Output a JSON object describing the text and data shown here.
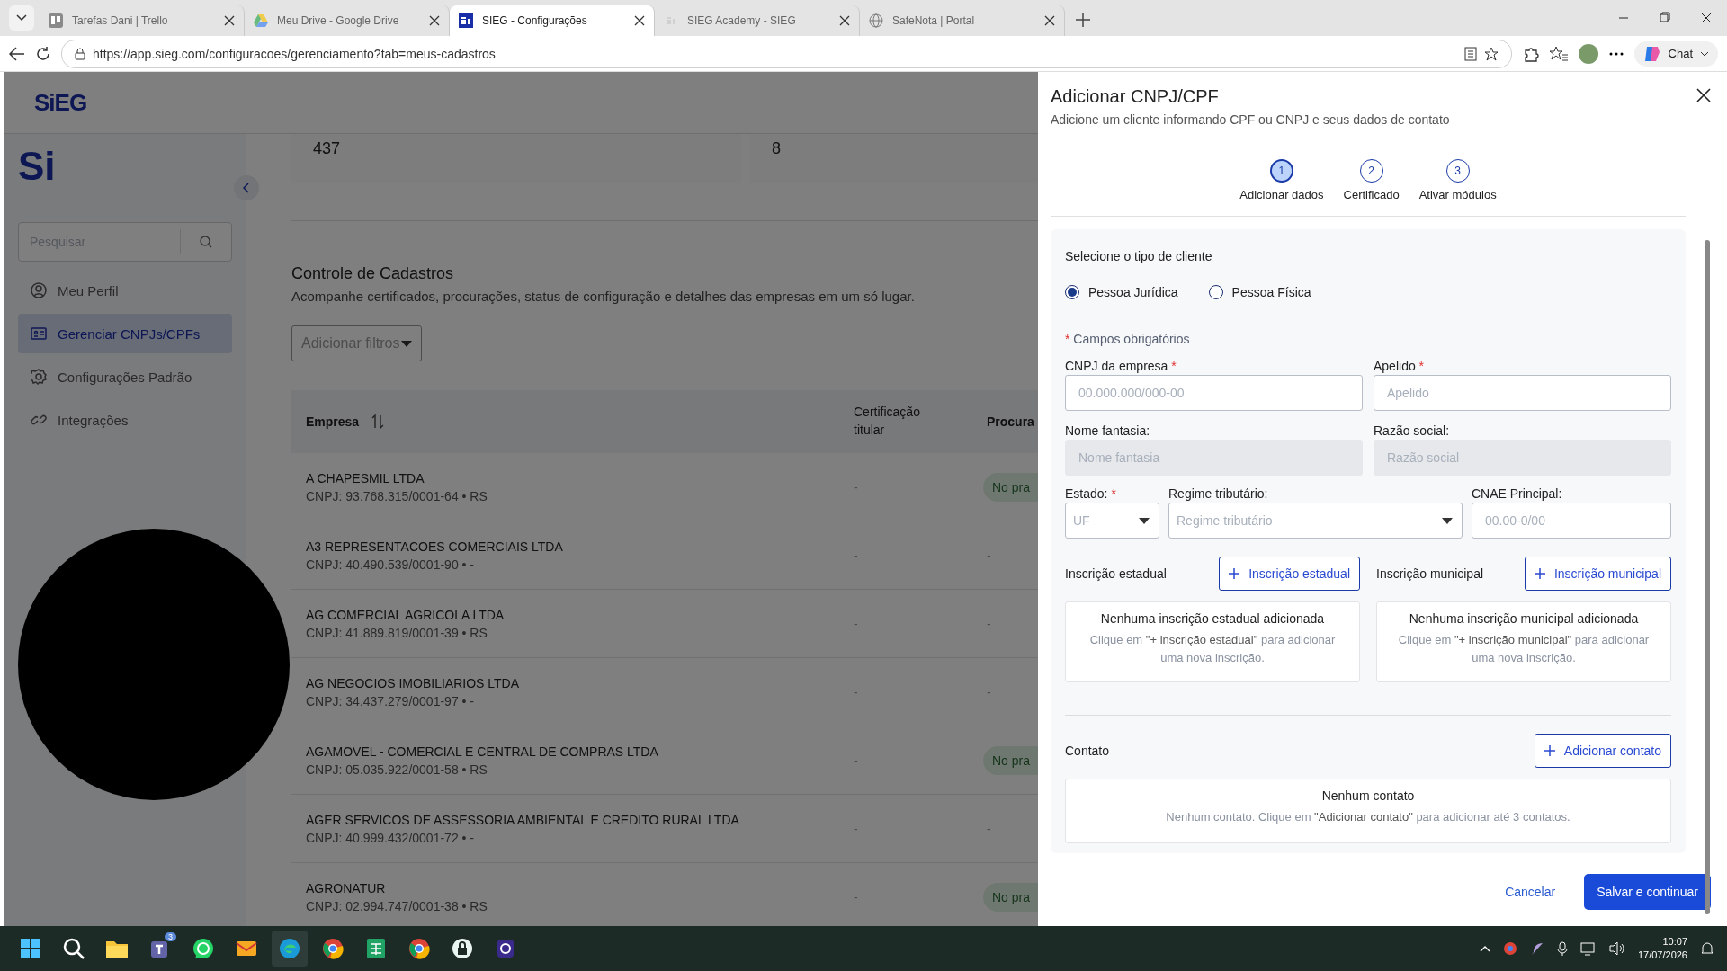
{
  "browser": {
    "tabs": [
      {
        "title": "Tarefas Dani | Trello",
        "kind": "board",
        "selected": false
      },
      {
        "title": "Meu Drive - Google Drive",
        "kind": "drive",
        "selected": false
      },
      {
        "title": "SIEG - Configurações",
        "kind": "sieg",
        "selected": true
      },
      {
        "title": "SIEG Academy - SIEG",
        "kind": "sieg-faded",
        "selected": false
      },
      {
        "title": "SafeNota | Portal",
        "kind": "globe",
        "selected": false
      }
    ],
    "url": "https://app.sieg.com/configuracoes/gerenciamento?tab=meus-cadastros",
    "chat": "Chat"
  },
  "app": {
    "logo": "SiEG",
    "side_logo": "Si",
    "search": {
      "placeholder": "Pesquisar"
    },
    "nav": [
      {
        "label": "Meu Perfil",
        "kind": "user",
        "selected": false
      },
      {
        "label": "Gerenciar CNPJs/CPFs",
        "kind": "card",
        "selected": true
      },
      {
        "label": "Configurações Padrão",
        "kind": "gear",
        "selected": false
      },
      {
        "label": "Integrações",
        "kind": "link",
        "selected": false
      }
    ],
    "stats": [
      "437",
      "8"
    ],
    "section": {
      "title": "Controle de Cadastros",
      "subtitle": "Acompanhe certificados, procurações, status de configuração e detalhes das empresas em um só lugar."
    },
    "filter_button": "Adicionar filtros",
    "table": {
      "columns": [
        "Empresa",
        "Certificação titular",
        "Procura"
      ],
      "rows": [
        {
          "name": "A CHAPESMIL LTDA",
          "cnpj": "CNPJ: 93.768.315/0001-64 • RS",
          "certificacao": "-",
          "procuracao": {
            "kind": "badge",
            "text": "No pra"
          }
        },
        {
          "name": "A3 REPRESENTACOES COMERCIAIS LTDA",
          "cnpj": "CNPJ: 40.490.539/0001-90 • -",
          "certificacao": "-",
          "procuracao": {
            "kind": "plain",
            "text": "-"
          }
        },
        {
          "name": "AG COMERCIAL AGRICOLA LTDA",
          "cnpj": "CNPJ: 41.889.819/0001-39 • RS",
          "certificacao": "-",
          "procuracao": {
            "kind": "plain",
            "text": "-"
          }
        },
        {
          "name": "AG NEGOCIOS IMOBILIARIOS LTDA",
          "cnpj": "CNPJ: 34.437.279/0001-97 • -",
          "certificacao": "-",
          "procuracao": {
            "kind": "plain",
            "text": "-"
          }
        },
        {
          "name": "AGAMOVEL - COMERCIAL E CENTRAL DE COMPRAS LTDA",
          "cnpj": "CNPJ: 05.035.922/0001-58 • RS",
          "certificacao": "-",
          "procuracao": {
            "kind": "badge",
            "text": "No pra"
          }
        },
        {
          "name": "AGER SERVICOS DE ASSESSORIA AMBIENTAL E CREDITO RURAL LTDA",
          "cnpj": "CNPJ: 40.999.432/0001-72 • -",
          "certificacao": "-",
          "procuracao": {
            "kind": "plain",
            "text": "-"
          }
        },
        {
          "name": "AGRONATUR",
          "cnpj": "CNPJ: 02.994.747/0001-38 • RS",
          "certificacao": "-",
          "procuracao": {
            "kind": "badge",
            "text": "No pra"
          }
        }
      ]
    }
  },
  "drawer": {
    "title": "Adicionar CNPJ/CPF",
    "subtitle": "Adicione um cliente informando CPF ou CNPJ e seus dados de contato",
    "steps": [
      {
        "number": "1",
        "label": "Adicionar dados",
        "selected": true
      },
      {
        "number": "2",
        "label": "Certificado",
        "selected": false
      },
      {
        "number": "3",
        "label": "Ativar módulos",
        "selected": false
      }
    ],
    "client_type": {
      "label": "Selecione o tipo de cliente",
      "options": [
        {
          "label": "Pessoa Jurídica",
          "selected": true
        },
        {
          "label": "Pessoa Física",
          "selected": false
        }
      ]
    },
    "required_mark": "*",
    "required_note": "Campos obrigatórios",
    "fields": [
      {
        "label": "CNPJ da empresa",
        "required": true,
        "placeholder": "00.000.000/000-00",
        "kind": "input",
        "disabled": false
      },
      {
        "label": "Apelido",
        "required": true,
        "placeholder": "Apelido",
        "kind": "input",
        "disabled": false
      },
      {
        "label": "Nome fantasia:",
        "required": false,
        "placeholder": "Nome fantasia",
        "kind": "input",
        "disabled": true
      },
      {
        "label": "Razão social:",
        "required": false,
        "placeholder": "Razão social",
        "kind": "input",
        "disabled": true
      },
      {
        "label": "Estado:",
        "required": true,
        "placeholder": "UF",
        "kind": "select",
        "disabled": false
      },
      {
        "label": "Regime tributário:",
        "required": false,
        "placeholder": "Regime tributário",
        "kind": "select",
        "disabled": false
      },
      {
        "label": "CNAE Principal:",
        "required": false,
        "placeholder": "00.00-0/00",
        "kind": "input",
        "disabled": false
      }
    ],
    "registrations": [
      {
        "label": "Inscrição estadual",
        "button": "Inscrição estadual",
        "empty_title": "Nenhuma inscrição estadual adicionada",
        "empty_text": "Clique em **\"+ inscrição estadual\"** para adicionar uma nova inscrição."
      },
      {
        "label": "Inscrição municipal",
        "button": "Inscrição municipal",
        "empty_title": "Nenhuma inscrição municipal adicionada",
        "empty_text": "Clique em **\"+ inscrição municipal\"** para adicionar uma nova inscrição."
      }
    ],
    "contact": {
      "label": "Contato",
      "button": "Adicionar contato",
      "empty_title": "Nenhum contato",
      "empty_text": "Nenhum contato. Clique em **\"Adicionar contato\"** para adicionar até 3 contatos."
    },
    "cancel": "Cancelar",
    "submit": "Salvar e continuar"
  },
  "taskbar": {
    "apps": [
      {
        "kind": "start",
        "selected": false
      },
      {
        "kind": "search",
        "selected": false
      },
      {
        "kind": "folder",
        "selected": false
      },
      {
        "kind": "teams",
        "badge": "3",
        "selected": false
      },
      {
        "kind": "whatsapp",
        "selected": false
      },
      {
        "kind": "mail",
        "selected": false
      },
      {
        "kind": "edge",
        "selected": true
      },
      {
        "kind": "chrome",
        "selected": false
      },
      {
        "kind": "sheet",
        "selected": false
      },
      {
        "kind": "chrome",
        "selected": false
      },
      {
        "kind": "lock",
        "selected": false
      },
      {
        "kind": "app",
        "selected": false
      }
    ],
    "time": "10:07",
    "date": "17/07/2026"
  }
}
